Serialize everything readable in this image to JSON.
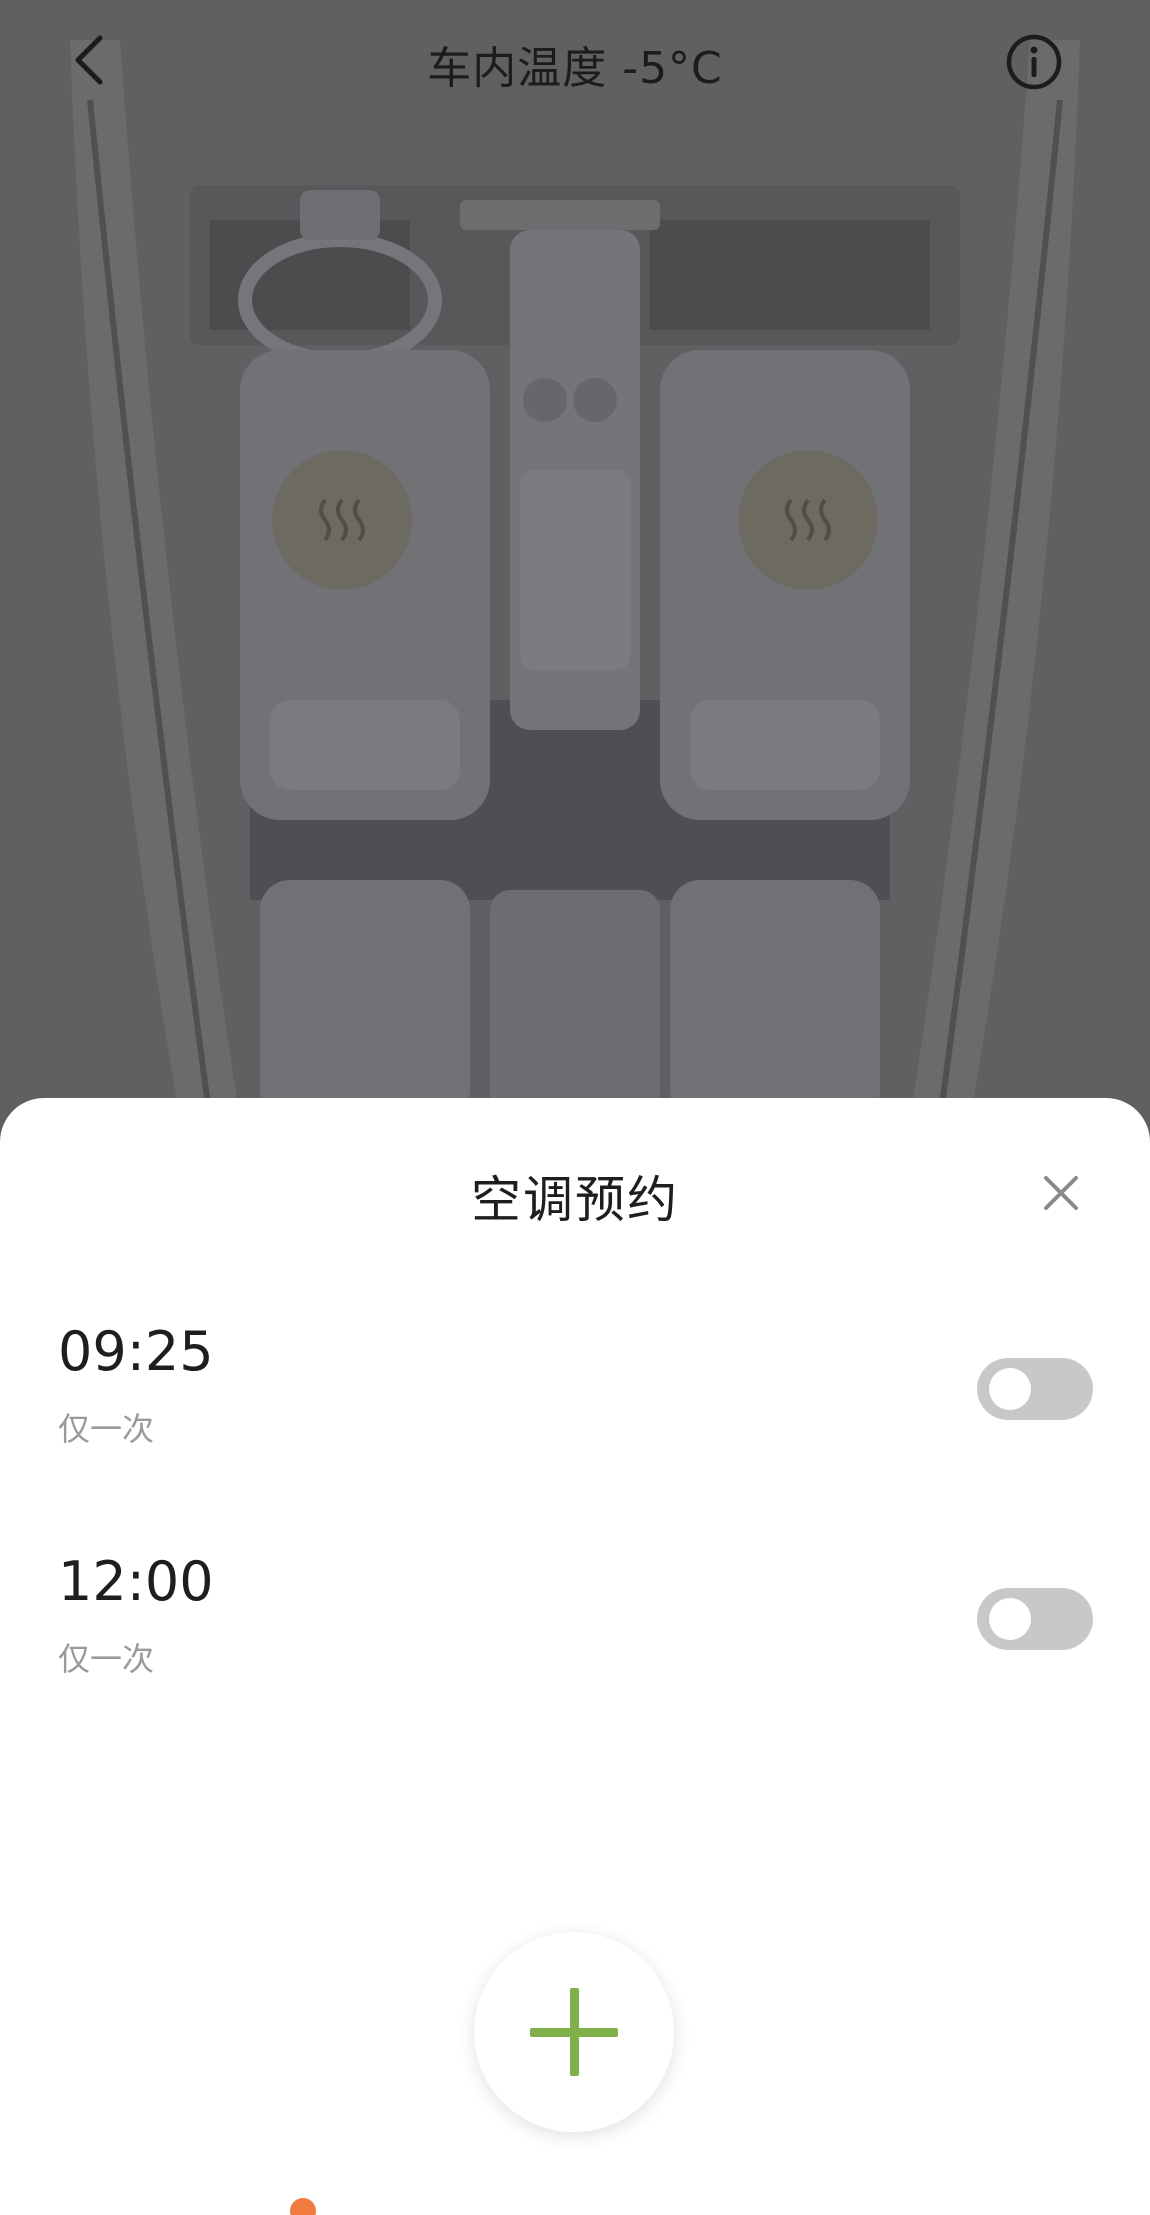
{
  "header": {
    "title": "车内温度 -5°C",
    "back_icon": "chevron-left-icon",
    "info_icon": "info-icon"
  },
  "car_view": {
    "seat_heat_left_icon": "seat-heat-icon",
    "seat_heat_right_icon": "seat-heat-icon"
  },
  "sheet": {
    "title": "空调预约",
    "close_icon": "close-icon",
    "schedules": [
      {
        "time": "09:25",
        "repeat": "仅一次",
        "enabled": false
      },
      {
        "time": "12:00",
        "repeat": "仅一次",
        "enabled": false
      }
    ],
    "add_icon": "plus-icon"
  },
  "colors": {
    "accent": "#7fb04a",
    "toggle_off": "#c8c8c8",
    "overlay": "#5f6062"
  }
}
